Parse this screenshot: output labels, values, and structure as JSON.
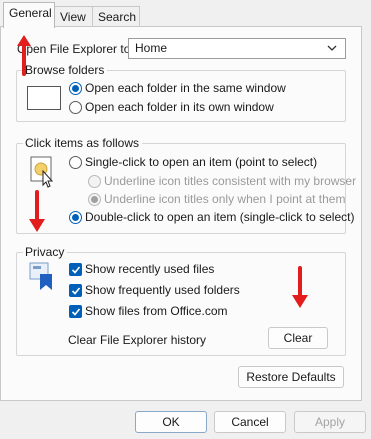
{
  "tabs": [
    "General",
    "View",
    "Search"
  ],
  "open_explorer": {
    "label": "Open File Explorer to:",
    "value": "Home"
  },
  "browse_folders": {
    "title": "Browse folders",
    "options": [
      "Open each folder in the same window",
      "Open each folder in its own window"
    ],
    "selected": 0
  },
  "click_items": {
    "title": "Click items as follows",
    "single": "Single-click to open an item (point to select)",
    "underline_browser": "Underline icon titles consistent with my browser",
    "underline_point": "Underline icon titles only when I point at them",
    "double": "Double-click to open an item (single-click to select)"
  },
  "privacy": {
    "title": "Privacy",
    "checks": [
      "Show recently used files",
      "Show frequently used folders",
      "Show files from Office.com"
    ],
    "clear_label": "Clear File Explorer history",
    "clear_button": "Clear"
  },
  "restore_button": "Restore Defaults",
  "footer": {
    "ok": "OK",
    "cancel": "Cancel",
    "apply": "Apply"
  },
  "colors": {
    "accent": "#005fb8",
    "annotation_arrow": "#e11d1d"
  }
}
